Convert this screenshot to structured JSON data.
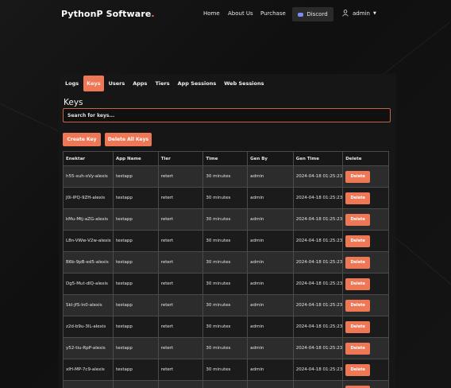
{
  "nav": {
    "brand": "PythonP Software",
    "brand_dot": ".",
    "links": [
      "Home",
      "About Us",
      "Purchase"
    ],
    "discord_label": "Discord",
    "user_label": "admin"
  },
  "tabs": [
    "Logs",
    "Keys",
    "Users",
    "Apps",
    "Tiers",
    "App Sessions",
    "Web Sessions"
  ],
  "active_tab": "Keys",
  "section_title": "Keys",
  "search": {
    "placeholder": "Search for keys...",
    "value": ""
  },
  "buttons": {
    "create": "Create Key",
    "delete_all": "Delete All Keys"
  },
  "table": {
    "headers": [
      "Enektar",
      "App Name",
      "Tier",
      "Time",
      "Gen By",
      "Gen Time",
      "Delete"
    ],
    "delete_label": "Delete",
    "rows": [
      [
        "h55-xuh-oVy-alexis",
        "testapp",
        "retert",
        "30 minutes",
        "admin",
        "2024-04-18 01:25:23"
      ],
      [
        "J0i-lPQ-9ZH-alexis",
        "testapp",
        "retert",
        "30 minutes",
        "admin",
        "2024-04-18 01:25:23"
      ],
      [
        "kMu-Mtj-aZG-alexis",
        "testapp",
        "retert",
        "30 minutes",
        "admin",
        "2024-04-18 01:25:23"
      ],
      [
        "L8n-VWw-V2w-alexis",
        "testapp",
        "retert",
        "30 minutes",
        "admin",
        "2024-04-18 01:25:23"
      ],
      [
        "B6b-9pB-ed5-alexis",
        "testapp",
        "retert",
        "30 minutes",
        "admin",
        "2024-04-18 01:25:23"
      ],
      [
        "Dg5-Mut-dlQ-alexis",
        "testapp",
        "retert",
        "30 minutes",
        "admin",
        "2024-04-18 01:25:23"
      ],
      [
        "SkI-jfS-ln0-alexis",
        "testapp",
        "retert",
        "30 minutes",
        "admin",
        "2024-04-18 01:25:23"
      ],
      [
        "z2d-b9u-3IL-alexis",
        "testapp",
        "retert",
        "30 minutes",
        "admin",
        "2024-04-18 01:25:23"
      ],
      [
        "y52-tiu-RpP-alexis",
        "testapp",
        "retert",
        "30 minutes",
        "admin",
        "2024-04-18 01:25:23"
      ],
      [
        "xIH-MP-7c9-alexis",
        "testapp",
        "retert",
        "30 minutes",
        "admin",
        "2024-04-18 01:25:23"
      ],
      [
        "",
        "",
        "",
        "",
        "",
        ""
      ]
    ]
  },
  "colors": {
    "accent": "#ee7755",
    "background": "#121212",
    "panel": "#161616"
  }
}
